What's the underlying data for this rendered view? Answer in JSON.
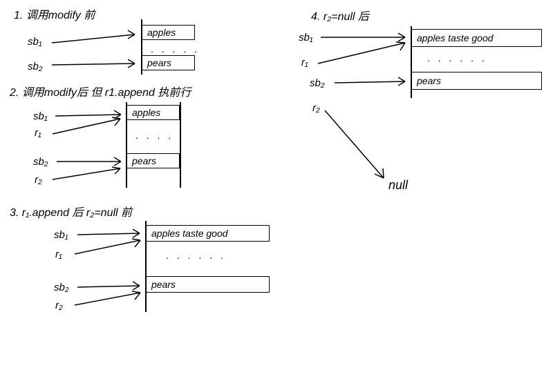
{
  "step1": {
    "title": "1. 调用modify 前",
    "sb1": "sb₁",
    "sb2": "sb₂",
    "box1": "apples",
    "dots": ". . . . .",
    "box2": "pears"
  },
  "step2": {
    "title": "2. 调用modify后  但 r1.append 执前行",
    "sb1": "sb₁",
    "r1": "r₁",
    "sb2": "sb₂",
    "r2": "r₂",
    "box1": "apples",
    "dots": ". . . . .",
    "box2": "pears"
  },
  "step3": {
    "title": "3. r₁.append 后  r₂=null 前",
    "sb1": "sb₁",
    "r1": "r₁",
    "sb2": "sb₂",
    "r2": "r₂",
    "box1": "apples  taste  good",
    "dots": ". . .  . . .",
    "box2": "pears"
  },
  "step4": {
    "title": "4. r₂=null 后",
    "sb1": "sb₁",
    "r1": "r₁",
    "sb2": "sb₂",
    "r2": "r₂",
    "box1": "apples  taste  good",
    "dots": ". . . . . .",
    "box2": "pears",
    "null": "null"
  }
}
